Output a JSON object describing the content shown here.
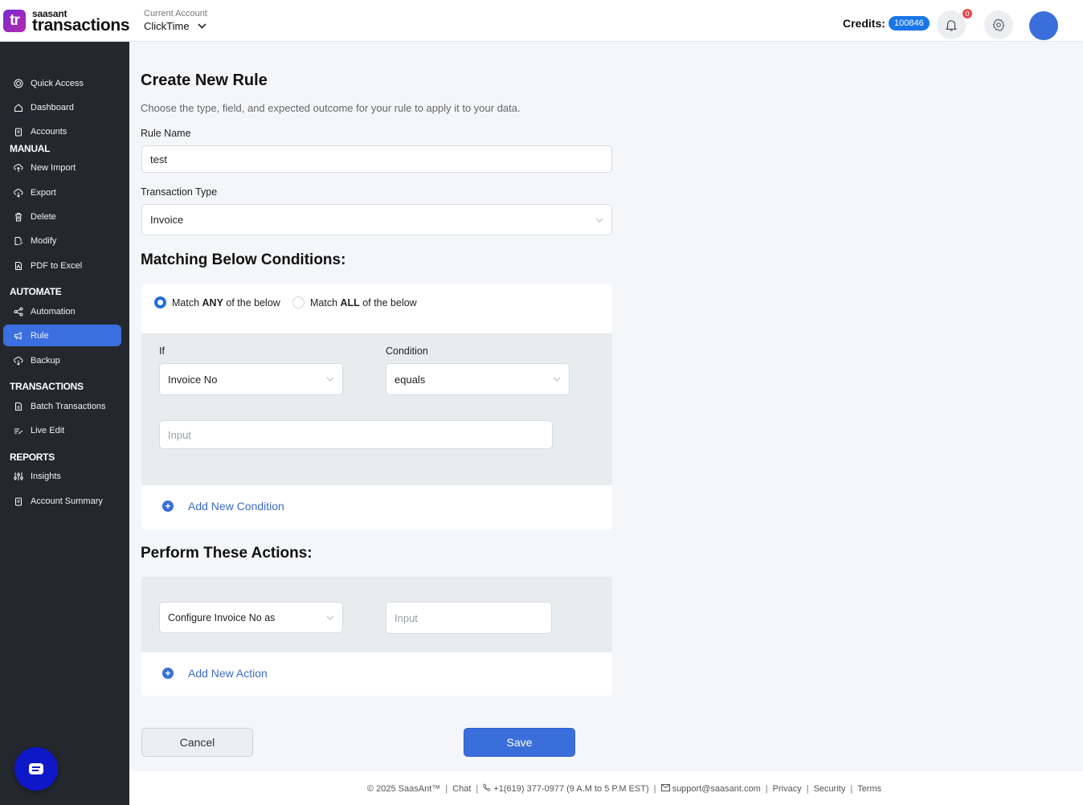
{
  "header": {
    "logo_text": "tr",
    "brand_small": "saasant",
    "brand_big": "transactions",
    "account_label": "Current Account",
    "account_value": "ClickTime",
    "credits_label": "Credits:",
    "credits_value": "100846",
    "notification_count": "0"
  },
  "sidebar": {
    "items": [
      {
        "label": "Quick Access",
        "icon": "target-icon"
      },
      {
        "label": "Dashboard",
        "icon": "home-icon"
      },
      {
        "label": "Accounts",
        "icon": "clipboard-icon"
      }
    ],
    "sections": [
      {
        "title": "MANUAL",
        "items": [
          {
            "label": "New Import",
            "icon": "cloud-upload-icon"
          },
          {
            "label": "Export",
            "icon": "cloud-download-icon"
          },
          {
            "label": "Delete",
            "icon": "trash-icon"
          },
          {
            "label": "Modify",
            "icon": "edit-file-icon"
          },
          {
            "label": "PDF to Excel",
            "icon": "pdf-icon"
          }
        ]
      },
      {
        "title": "AUTOMATE",
        "items": [
          {
            "label": "Automation",
            "icon": "share-nodes-icon"
          },
          {
            "label": "Rule",
            "icon": "megaphone-icon",
            "active": true
          },
          {
            "label": "Backup",
            "icon": "cloud-download-icon"
          }
        ]
      },
      {
        "title": "TRANSACTIONS",
        "items": [
          {
            "label": "Batch Transactions",
            "icon": "document-icon"
          },
          {
            "label": "Live Edit",
            "icon": "pencil-lines-icon"
          }
        ]
      },
      {
        "title": "REPORTS",
        "items": [
          {
            "label": "Insights",
            "icon": "sliders-icon"
          },
          {
            "label": "Account Summary",
            "icon": "clipboard-icon"
          }
        ]
      }
    ]
  },
  "main": {
    "title": "Create New Rule",
    "subtitle": "Choose the type, field, and expected outcome for your rule to apply it to your data.",
    "rule_name_label": "Rule Name",
    "rule_name_value": "test",
    "transaction_type_label": "Transaction Type",
    "transaction_type_value": "Invoice",
    "conditions_heading": "Matching Below Conditions:",
    "match_any": {
      "prefix": "Match ",
      "bold": "ANY",
      "suffix": " of the below",
      "selected": true
    },
    "match_all": {
      "prefix": "Match ",
      "bold": "ALL",
      "suffix": " of the below",
      "selected": false
    },
    "if_label": "If",
    "if_value": "Invoice No",
    "condition_label": "Condition",
    "condition_value": "equals",
    "condition_input_placeholder": "Input",
    "add_condition_label": "Add New Condition",
    "actions_heading": "Perform These Actions:",
    "action_field_value": "Configure Invoice No as",
    "action_input_placeholder": "Input",
    "add_action_label": "Add New Action",
    "cancel_label": "Cancel",
    "save_label": "Save"
  },
  "footer": {
    "copyright": "© 2025 SaasAnt™",
    "chat": "Chat",
    "phone": "+1(619) 377-0977 (9 A.M to 5 P.M EST)",
    "email": "support@saasant.com",
    "privacy": "Privacy",
    "security": "Security",
    "terms": "Terms"
  }
}
